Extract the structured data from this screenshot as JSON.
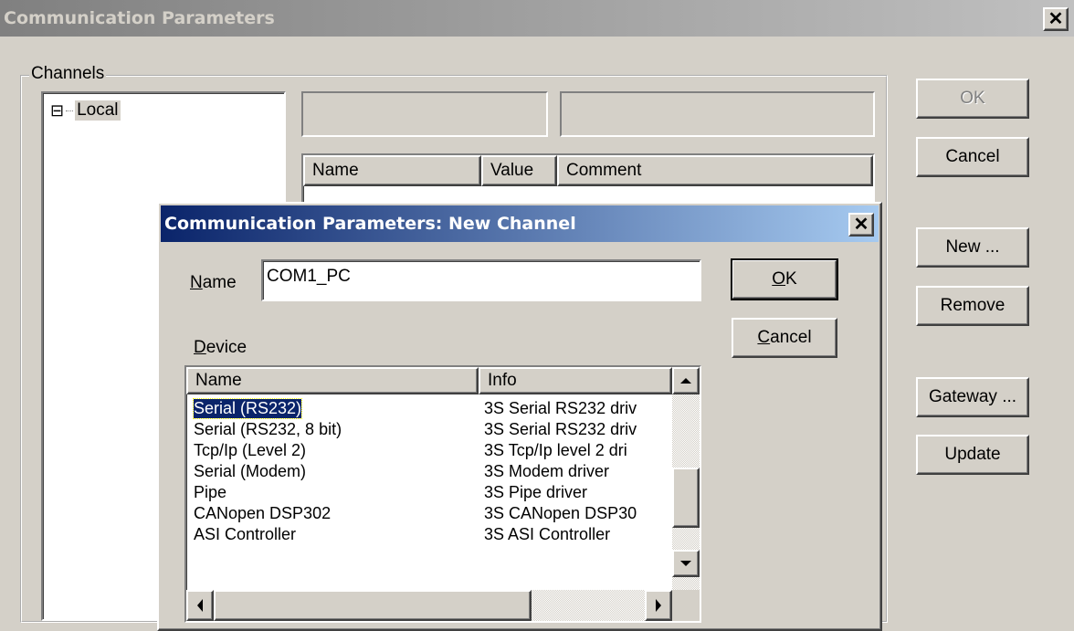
{
  "main_window": {
    "title": "Communication Parameters",
    "close_glyph": "✕"
  },
  "channels": {
    "group_label": "Channels",
    "tree": [
      {
        "expander": "⊟",
        "label": "Local"
      }
    ]
  },
  "param_table": {
    "headers": [
      "Name",
      "Value",
      "Comment"
    ]
  },
  "main_buttons": {
    "ok": "OK",
    "cancel": "Cancel",
    "new": "New ...",
    "remove": "Remove",
    "gateway": "Gateway ...",
    "update": "Update"
  },
  "dialog": {
    "title": "Communication Parameters: New Channel",
    "close_glyph": "✕",
    "name_label_ul": "N",
    "name_label_rest": "ame",
    "name_value": "COM1_PC",
    "ok_ul": "O",
    "ok_rest": "K",
    "cancel_ul": "C",
    "cancel_rest": "ancel",
    "device_label_ul": "D",
    "device_label_rest": "evice",
    "device_headers": [
      "Name",
      "Info"
    ],
    "devices": [
      {
        "name": "Serial (RS232)",
        "info": "3S Serial RS232 driv",
        "selected": true
      },
      {
        "name": "Serial (RS232, 8 bit)",
        "info": "3S Serial RS232 driv"
      },
      {
        "name": "Tcp/Ip (Level 2)",
        "info": "3S Tcp/Ip level 2 dri"
      },
      {
        "name": "Serial (Modem)",
        "info": "3S Modem driver"
      },
      {
        "name": "Pipe",
        "info": "3S Pipe driver"
      },
      {
        "name": "CANopen DSP302",
        "info": "3S CANopen DSP30"
      },
      {
        "name": "ASI Controller",
        "info": "3S ASI Controller"
      }
    ]
  },
  "icons": {
    "scroll_up": "up-arrow-icon",
    "scroll_down": "down-arrow-icon",
    "scroll_left": "left-arrow-icon",
    "scroll_right": "right-arrow-icon"
  },
  "colors": {
    "main_title_bg": "#808080",
    "dialog_title_bg": "#0a246a",
    "selection": "#0a246a"
  }
}
